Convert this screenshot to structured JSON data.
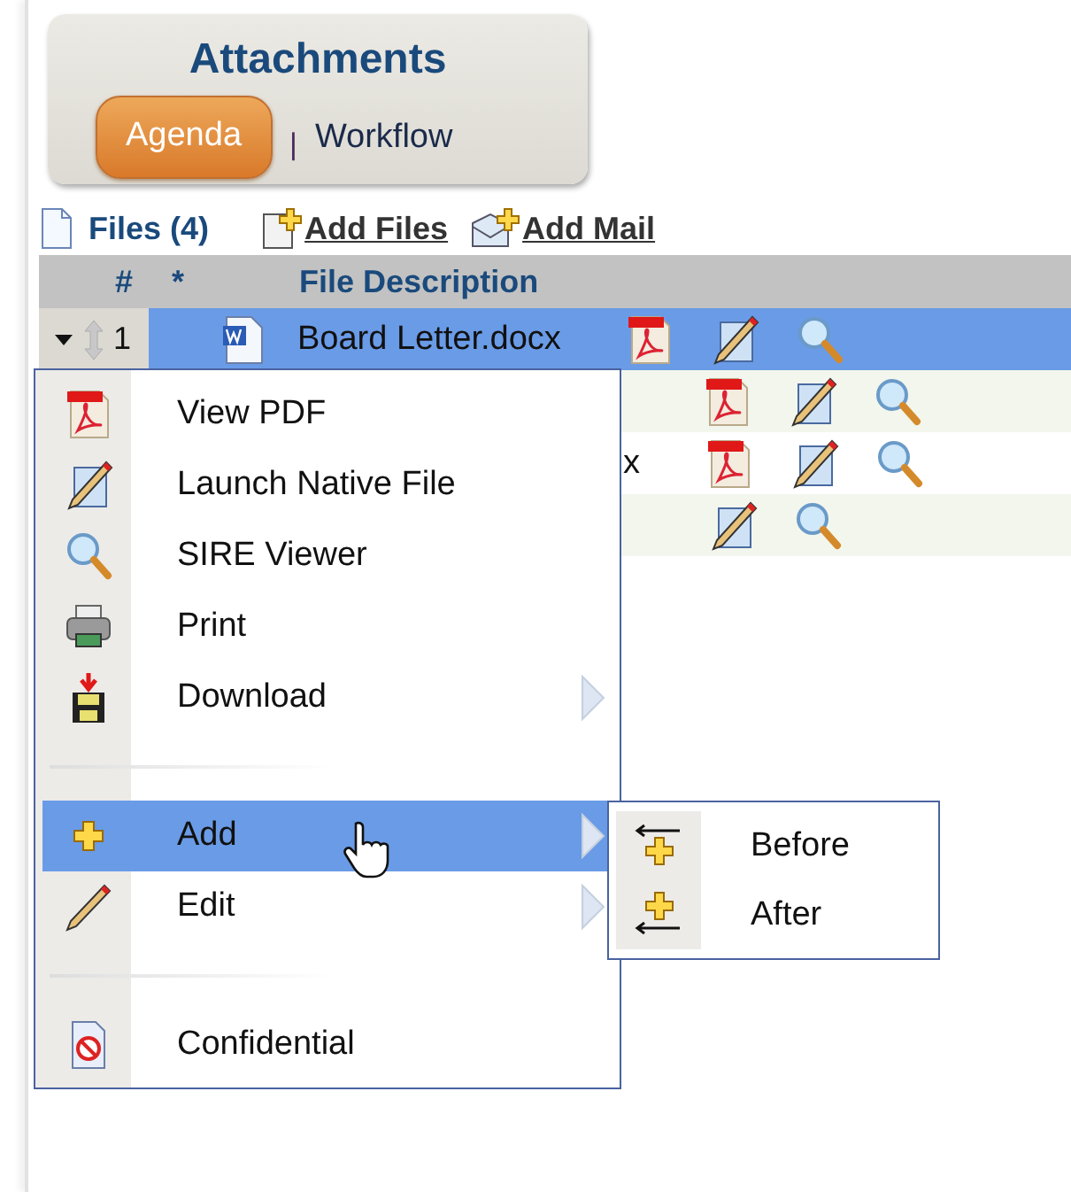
{
  "panel": {
    "title": "Attachments",
    "tab_separator": "|",
    "tabs": [
      {
        "label": "Agenda",
        "selected": true
      },
      {
        "label": "Workflow",
        "selected": false
      }
    ]
  },
  "toolbar": {
    "files_label": "Files (4)",
    "links": [
      "Add Files",
      "Add Mail"
    ]
  },
  "table": {
    "columns": [
      "#",
      "*",
      "File Description"
    ],
    "rows": [
      {
        "number": "1",
        "name": "Board Letter.docx",
        "selected": true
      },
      {
        "selected": false
      },
      {
        "name": "x",
        "selected": false
      },
      {
        "selected": false
      }
    ]
  },
  "context_menu": {
    "items": [
      {
        "kind": "item",
        "label": "View PDF",
        "has_submenu": false,
        "selected": false
      },
      {
        "kind": "item",
        "label": "Launch Native File",
        "has_submenu": false,
        "selected": false
      },
      {
        "kind": "item",
        "label": "SIRE Viewer",
        "has_submenu": false,
        "selected": false
      },
      {
        "kind": "item",
        "label": "Print",
        "has_submenu": false,
        "selected": false
      },
      {
        "kind": "item",
        "label": "Download",
        "has_submenu": true,
        "selected": false
      },
      {
        "kind": "separator"
      },
      {
        "kind": "item",
        "label": "Add",
        "has_submenu": true,
        "selected": true
      },
      {
        "kind": "item",
        "label": "Edit",
        "has_submenu": true,
        "selected": false
      },
      {
        "kind": "separator"
      },
      {
        "kind": "item",
        "label": "Confidential",
        "has_submenu": false,
        "selected": false
      }
    ]
  },
  "submenu": {
    "items": [
      {
        "label": "Before",
        "selected": false
      },
      {
        "label": "After",
        "selected": false
      }
    ]
  }
}
